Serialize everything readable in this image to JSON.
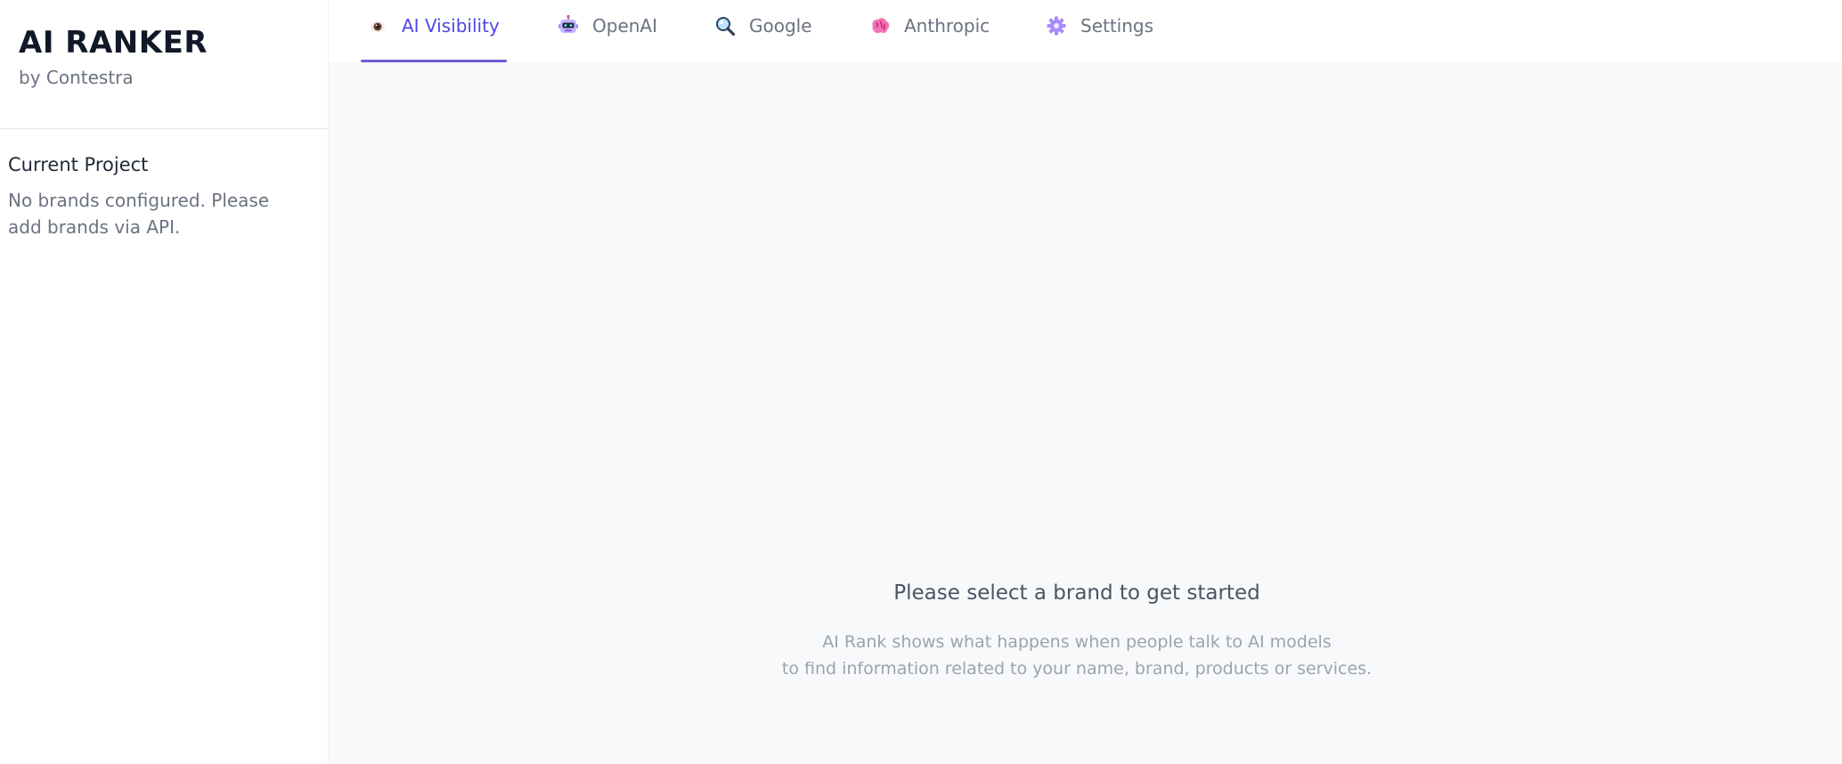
{
  "sidebar": {
    "app_title": "AI RANKER",
    "app_subtitle": "by Contestra",
    "project_heading": "Current Project",
    "project_note": "No brands configured. Please add brands via API."
  },
  "tabs": [
    {
      "label": "AI Visibility",
      "icon": "eye-icon",
      "active": true
    },
    {
      "label": "OpenAI",
      "icon": "robot-icon",
      "active": false
    },
    {
      "label": "Google",
      "icon": "magnifier-icon",
      "active": false
    },
    {
      "label": "Anthropic",
      "icon": "brain-icon",
      "active": false
    },
    {
      "label": "Settings",
      "icon": "gear-icon",
      "active": false
    }
  ],
  "main": {
    "empty_title": "Please select a brand to get started",
    "empty_desc_line1": "AI Rank shows what happens when people talk to AI models",
    "empty_desc_line2": "to find information related to your name, brand, products or services."
  },
  "colors": {
    "accent": "#4f46e5",
    "tab_underline": "#6d5dd3",
    "background": "#f8f9fb"
  }
}
